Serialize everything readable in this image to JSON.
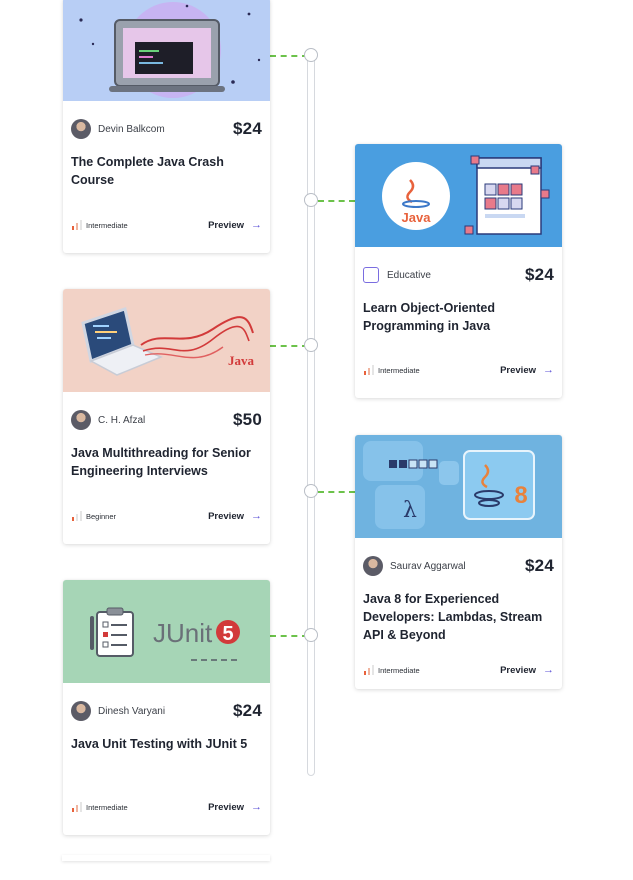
{
  "cards": [
    {
      "author": "Devin Balkcom",
      "price": "$24",
      "title": "The Complete Java Crash Course",
      "level": "Intermediate",
      "preview": "Preview",
      "thumb": "laptop-code-icon"
    },
    {
      "author": "Educative",
      "price": "$24",
      "title": "Learn Object-Oriented Programming in Java",
      "level": "Intermediate",
      "preview": "Preview",
      "thumb": "java-oop-icon"
    },
    {
      "author": "C. H. Afzal",
      "price": "$50",
      "title": "Java Multithreading for Senior Engineering Interviews",
      "level": "Beginner",
      "preview": "Preview",
      "thumb": "laptop-threads-icon"
    },
    {
      "author": "Saurav Aggarwal",
      "price": "$24",
      "title": "Java 8 for Experienced Developers: Lambdas, Stream API & Beyond",
      "level": "Intermediate",
      "preview": "Preview",
      "thumb": "java8-lambda-icon"
    },
    {
      "author": "Dinesh Varyani",
      "price": "$24",
      "title": "Java Unit Testing with JUnit 5",
      "level": "Intermediate",
      "preview": "Preview",
      "thumb": "junit5-icon"
    }
  ],
  "thumb_text": {
    "java_logo": "Java",
    "java_word": "Java",
    "lambda": "λ",
    "eight": "8",
    "junit": "JUnit",
    "five": "5"
  },
  "colors": {
    "accent": "#5a4fd6",
    "connector": "#6cc24a",
    "timeline": "#d6d9de",
    "level_bars": "#e8623c"
  }
}
